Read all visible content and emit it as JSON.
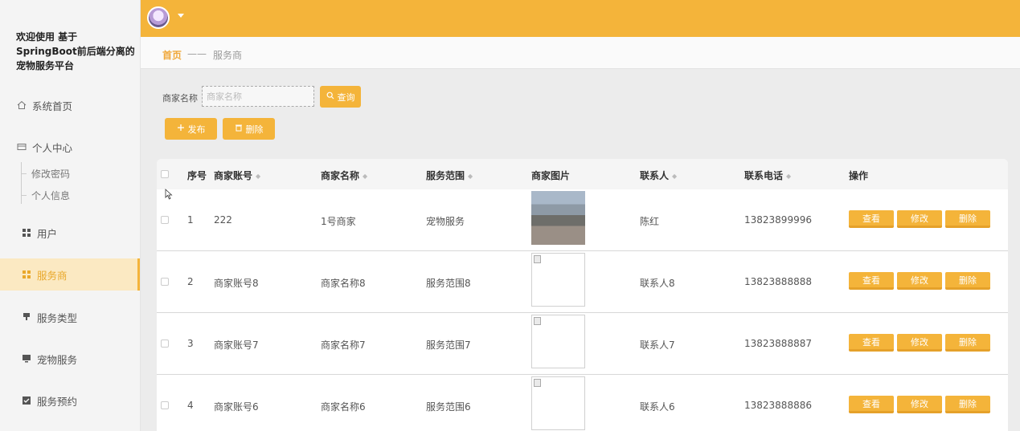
{
  "sidebar": {
    "brand": "欢迎使用 基于SpringBoot前后端分离的宠物服务平台",
    "items": [
      {
        "label": "系统首页",
        "icon": "home-icon"
      },
      {
        "label": "个人中心",
        "icon": "card-icon"
      },
      {
        "label": "用户",
        "icon": "grid-icon"
      },
      {
        "label": "服务商",
        "icon": "grid-icon"
      },
      {
        "label": "服务类型",
        "icon": "stand-icon"
      },
      {
        "label": "宠物服务",
        "icon": "monitor-icon"
      },
      {
        "label": "服务预约",
        "icon": "check-icon"
      }
    ],
    "subitems": [
      "修改密码",
      "个人信息"
    ],
    "active": "服务商"
  },
  "breadcrumb": {
    "home": "首页",
    "separator": "——",
    "current": "服务商"
  },
  "search": {
    "label": "商家名称",
    "placeholder": "商家名称",
    "query_label": "查询"
  },
  "actions": {
    "publish_label": "发布",
    "delete_label": "删除"
  },
  "table": {
    "headers": [
      "序号",
      "商家账号",
      "商家名称",
      "服务范围",
      "商家图片",
      "联系人",
      "联系电话",
      "操作"
    ],
    "rows": [
      {
        "index": "1",
        "account": "222",
        "name": "1号商家",
        "scope": "宠物服务",
        "contact": "陈红",
        "phone": "13823899996"
      },
      {
        "index": "2",
        "account": "商家账号8",
        "name": "商家名称8",
        "scope": "服务范围8",
        "contact": "联系人8",
        "phone": "13823888888"
      },
      {
        "index": "3",
        "account": "商家账号7",
        "name": "商家名称7",
        "scope": "服务范围7",
        "contact": "联系人7",
        "phone": "13823888887"
      },
      {
        "index": "4",
        "account": "商家账号6",
        "name": "商家名称6",
        "scope": "服务范围6",
        "contact": "联系人6",
        "phone": "13823888886"
      }
    ],
    "row_actions": {
      "view": "查看",
      "edit": "修改",
      "delete": "删除"
    }
  },
  "colors": {
    "accent": "#f4b43a",
    "active_bg": "#fde8b8"
  }
}
